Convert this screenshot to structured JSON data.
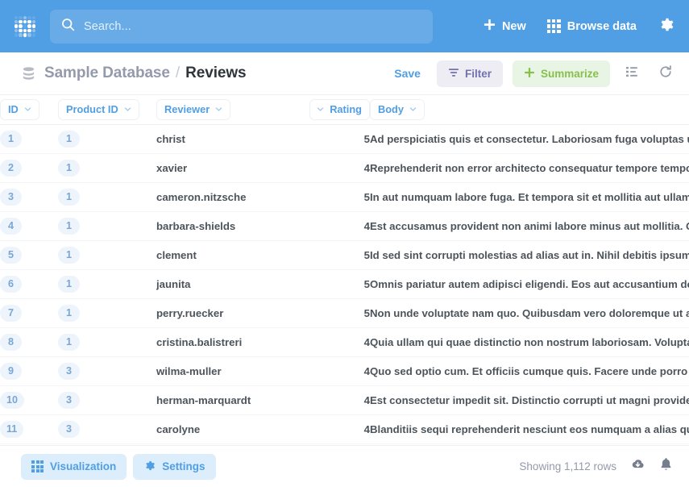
{
  "nav": {
    "logo_icon": "metabase-dot-grid-logo",
    "search": {
      "placeholder": "Search...",
      "value": "",
      "icon": "search-icon"
    },
    "new_label": "New",
    "new_icon": "plus-icon",
    "browse_label": "Browse data",
    "browse_icon": "grid-icon",
    "settings_icon": "gear-icon",
    "bg_color": "#509EE3"
  },
  "question_header": {
    "db_icon": "database-icon",
    "database": "Sample Database",
    "separator": "/",
    "table": "Reviews",
    "save_label": "Save",
    "filter_label": "Filter",
    "filter_icon": "filter-funnel-icon",
    "summarize_label": "Summarize",
    "summarize_icon": "plus-icon",
    "row_view_icon": "list-detail-icon",
    "refresh_icon": "refresh-icon",
    "filter_color": "#7172AD",
    "summarize_color": "#88BF4D"
  },
  "table": {
    "columns": [
      {
        "label": "ID",
        "align": "left",
        "chevron": "right"
      },
      {
        "label": "Product ID",
        "align": "left",
        "chevron": "right"
      },
      {
        "label": "Reviewer",
        "align": "left",
        "chevron": "right"
      },
      {
        "label": "Rating",
        "align": "right",
        "chevron": "left"
      },
      {
        "label": "Body",
        "align": "left",
        "chevron": "right"
      }
    ],
    "rows": [
      {
        "id": "1",
        "product_id": "1",
        "reviewer": "christ",
        "rating": "5",
        "body": "Ad perspiciatis quis et consectetur. Laboriosam fuga voluptas ut et modi ipsum. Odio et eos nihil sed quis blanditiis."
      },
      {
        "id": "2",
        "product_id": "1",
        "reviewer": "xavier",
        "rating": "4",
        "body": "Reprehenderit non error architecto consequatur tempore tempora voluptatem. Est ut consequatur dolores non enim."
      },
      {
        "id": "3",
        "product_id": "1",
        "reviewer": "cameron.nitzsche",
        "rating": "5",
        "body": "In aut numquam labore fuga. Et tempora sit et mollitia aut ullam. Quis voluptatem sit omnis sed quod."
      },
      {
        "id": "4",
        "product_id": "1",
        "reviewer": "barbara-shields",
        "rating": "4",
        "body": "Est accusamus provident non animi labore minus aut mollitia. Quia qui sed sunt quia molestias ut."
      },
      {
        "id": "5",
        "product_id": "1",
        "reviewer": "clement",
        "rating": "5",
        "body": "Id sed sint corrupti molestias ad alias aut in. Nihil debitis ipsum odit vel et nemo quia."
      },
      {
        "id": "6",
        "product_id": "1",
        "reviewer": "jaunita",
        "rating": "5",
        "body": "Omnis pariatur autem adipisci eligendi. Eos aut accusantium dolorem eos quia nam iure."
      },
      {
        "id": "7",
        "product_id": "1",
        "reviewer": "perry.ruecker",
        "rating": "5",
        "body": "Non unde voluptate nam quo. Quibusdam vero doloremque ut aut repellat eum aliquam."
      },
      {
        "id": "8",
        "product_id": "1",
        "reviewer": "cristina.balistreri",
        "rating": "4",
        "body": "Quia ullam qui quae distinctio non nostrum laboriosam. Voluptates quia et quia ut ipsam sunt."
      },
      {
        "id": "9",
        "product_id": "3",
        "reviewer": "wilma-muller",
        "rating": "4",
        "body": "Quo sed optio cum. Et officiis cumque quis. Facere unde porro quasi consequatur nisi aut."
      },
      {
        "id": "10",
        "product_id": "3",
        "reviewer": "herman-marquardt",
        "rating": "4",
        "body": "Est consectetur impedit sit. Distinctio corrupti ut magni provident quia dolorum et."
      },
      {
        "id": "11",
        "product_id": "3",
        "reviewer": "carolyne",
        "rating": "4",
        "body": "Blanditiis sequi reprehenderit nesciunt eos numquam a alias quia ut aut velit."
      }
    ]
  },
  "footer": {
    "visualization_label": "Visualization",
    "visualization_icon": "grid-chart-icon",
    "settings_label": "Settings",
    "settings_icon": "gear-icon",
    "row_count": "Showing 1,112 rows",
    "download_icon": "download-cloud-icon",
    "alert_icon": "bell-icon"
  }
}
